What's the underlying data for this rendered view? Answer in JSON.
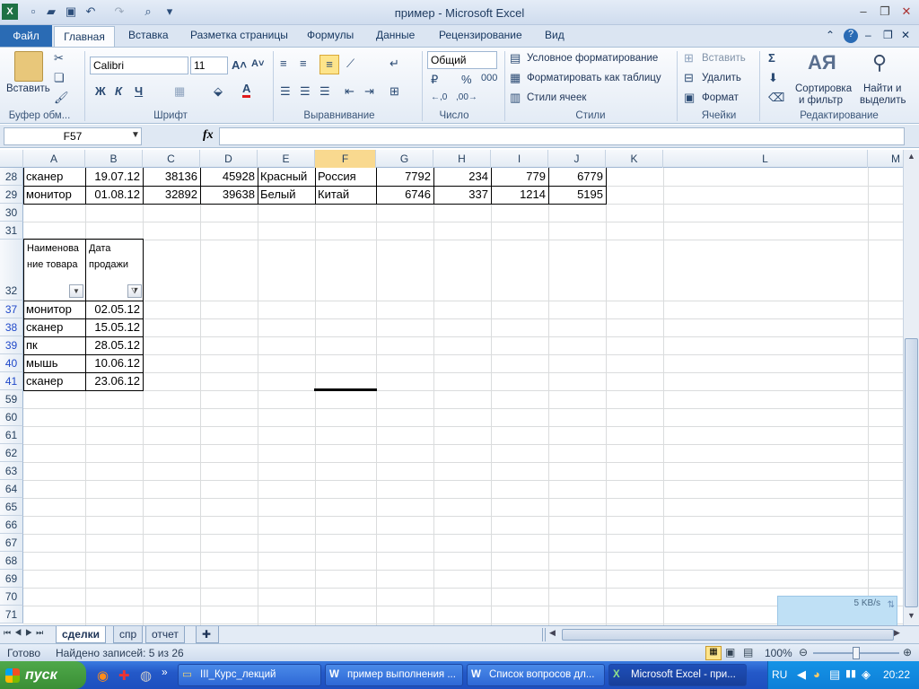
{
  "window": {
    "title": "пример  -  Microsoft Excel"
  },
  "ribbon": {
    "tabs": [
      "Файл",
      "Главная",
      "Вставка",
      "Разметка страницы",
      "Формулы",
      "Данные",
      "Рецензирование",
      "Вид"
    ],
    "clipboard": {
      "paste": "Вставить",
      "group": "Буфер обм..."
    },
    "font": {
      "name": "Calibri",
      "size": "11",
      "bold": "Ж",
      "italic": "К",
      "underline": "Ч",
      "group": "Шрифт"
    },
    "alignment": {
      "group": "Выравнивание"
    },
    "number": {
      "format": "Общий",
      "percent": "%",
      "thousands": "000",
      "group": "Число"
    },
    "styles": {
      "conditional": "Условное форматирование",
      "as_table": "Форматировать как таблицу",
      "cell_styles": "Стили ячеек",
      "group": "Стили"
    },
    "cells": {
      "insert": "Вставить",
      "delete": "Удалить",
      "format": "Формат",
      "group": "Ячейки"
    },
    "editing": {
      "sum": "Σ",
      "sort_filter_1": "Сортировка",
      "sort_filter_2": "и фильтр",
      "find_1": "Найти и",
      "find_2": "выделить",
      "group": "Редактирование"
    }
  },
  "formula_bar": {
    "name_box": "F57",
    "fx": "fx",
    "formula": ""
  },
  "columns": [
    "A",
    "B",
    "C",
    "D",
    "E",
    "F",
    "G",
    "H",
    "I",
    "J",
    "K",
    "L",
    "M"
  ],
  "rows": [
    {
      "num": "28",
      "cells": [
        "сканер",
        "19.07.12",
        "38136",
        "45928",
        "Красный",
        "Россия",
        "7792",
        "234",
        "779",
        "6779"
      ]
    },
    {
      "num": "29",
      "cells": [
        "монитор",
        "01.08.12",
        "32892",
        "39638",
        "Белый",
        "Китай",
        "6746",
        "337",
        "1214",
        "5195"
      ]
    },
    {
      "num": "30",
      "cells": []
    },
    {
      "num": "31",
      "cells": []
    }
  ],
  "filter_header": {
    "num": "32",
    "a": [
      "Наименова",
      "ние товара"
    ],
    "b": [
      "Дата",
      "продажи"
    ]
  },
  "filtered_rows": [
    {
      "num": "37",
      "name": "монитор",
      "date": "02.05.12"
    },
    {
      "num": "38",
      "name": "сканер",
      "date": "15.05.12"
    },
    {
      "num": "39",
      "name": "пк",
      "date": "28.05.12"
    },
    {
      "num": "40",
      "name": "мышь",
      "date": "10.06.12"
    },
    {
      "num": "41",
      "name": "сканер",
      "date": "23.06.12"
    }
  ],
  "empty_rows": [
    "59",
    "60",
    "61",
    "62",
    "63",
    "64",
    "65",
    "66",
    "67",
    "68",
    "69",
    "70",
    "71"
  ],
  "sheets": [
    "сделки",
    "спр",
    "отчет"
  ],
  "status": {
    "ready": "Готово",
    "found": "Найдено записей: 5 из 26",
    "zoom": "100%"
  },
  "network_widget": {
    "speed": "5 KB/s"
  },
  "taskbar": {
    "start": "пуск",
    "items": [
      "III_Курс_лекций",
      "пример выполнения ...",
      "Список вопросов дл...",
      "Microsoft Excel - при..."
    ],
    "lang": "RU",
    "clock": "20:22"
  }
}
